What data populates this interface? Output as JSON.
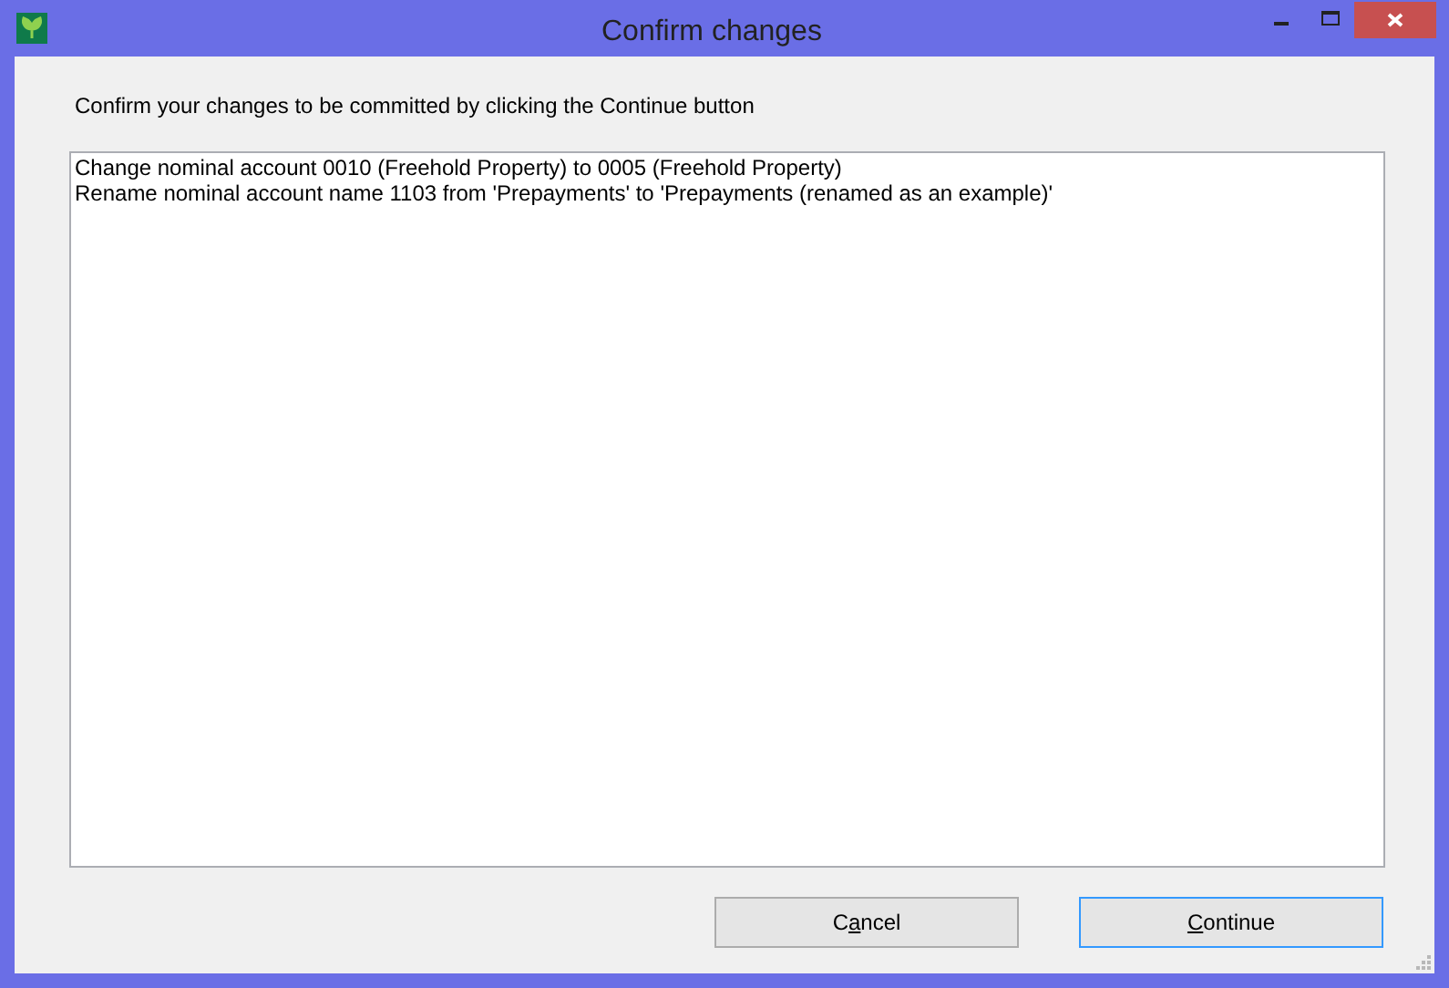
{
  "window": {
    "title": "Confirm changes"
  },
  "instruction": "Confirm your changes to be committed by clicking the Continue button",
  "changes": [
    "Change nominal account 0010 (Freehold Property) to 0005 (Freehold Property)",
    "Rename nominal account name 1103 from 'Prepayments' to 'Prepayments (renamed as an example)'"
  ],
  "buttons": [
    {
      "before": "C",
      "access_key": "a",
      "after": "ncel",
      "focused": false
    },
    {
      "access_key": "C",
      "after": "ontinue",
      "focused": true
    }
  ]
}
